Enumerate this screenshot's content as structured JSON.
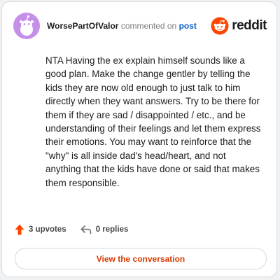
{
  "header": {
    "username": "WorsePartOfValor",
    "action_text": "commented on",
    "post_link": "post",
    "brand_name": "reddit"
  },
  "comment": {
    "text": "NTA Having the ex explain himself sounds like a good plan. Make the change gentler by telling the kids they are now old enough to just talk to him directly when they want answers. Try to be there for them if they are sad / disappointed / etc., and be understanding of their feelings and let them express their emotions. You may want to reinforce that the \"why\" is all inside dad's head/heart, and not anything that the kids have done or said that makes them responsible."
  },
  "footer": {
    "upvotes": "3 upvotes",
    "replies": "0 replies"
  },
  "cta": {
    "label": "View the conversation"
  },
  "colors": {
    "avatar_bg": "#c58ee8",
    "brand_orange": "#ff4500",
    "upvote_orange": "#ff4500",
    "cta_text": "#d93a00",
    "post_link": "#0a5dc2"
  },
  "icons": {
    "avatar": "snoo-avatar-icon",
    "logo": "reddit-snoo-icon",
    "upvote": "upvote-arrow-icon",
    "reply": "reply-arrow-icon"
  }
}
